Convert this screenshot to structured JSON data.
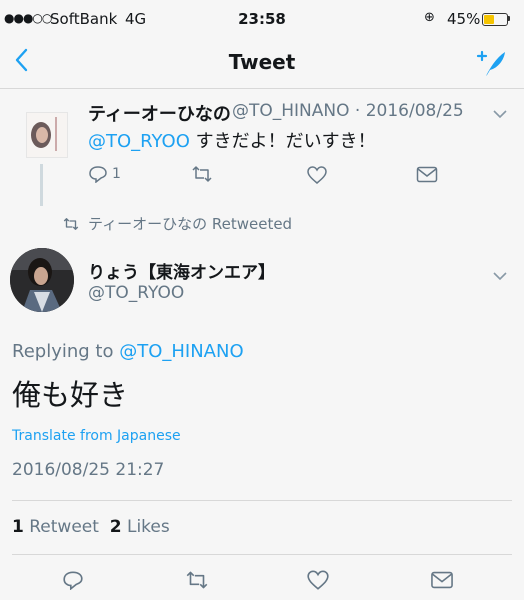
{
  "status_bar": {
    "signal": "●●●○○",
    "carrier": "SoftBank",
    "network": "4G",
    "time": "23:58",
    "rotation_lock": "⊕",
    "battery": "45%",
    "battery_level": 0.45
  },
  "nav": {
    "back": "<",
    "title": "Tweet",
    "compose_icon": "compose-tweet-icon"
  },
  "parent_tweet": {
    "name": "ティーオーひなの",
    "handle_date": "@TO_HINANO · 2016/08/25",
    "mention": "@TO_RYOO",
    "text": " すきだよ！だいすき！",
    "reply_count": "1"
  },
  "retweet_context": {
    "label": "ティーオーひなの Retweeted"
  },
  "main_tweet": {
    "name": "りょう【東海オンエア】",
    "handle": "@TO_RYOO",
    "replying_prefix": "Replying to ",
    "replying_to": "@TO_HINANO",
    "text": "俺も好き",
    "translate": "Translate from Japanese",
    "timestamp": "2016/08/25 21:27",
    "retweets_count": "1",
    "retweets_label": " Retweet",
    "likes_count": "2",
    "likes_label": " Likes"
  },
  "colors": {
    "accent": "#1da1f2",
    "muted": "#657786",
    "text": "#14171a",
    "background": "#f6f6f6"
  }
}
